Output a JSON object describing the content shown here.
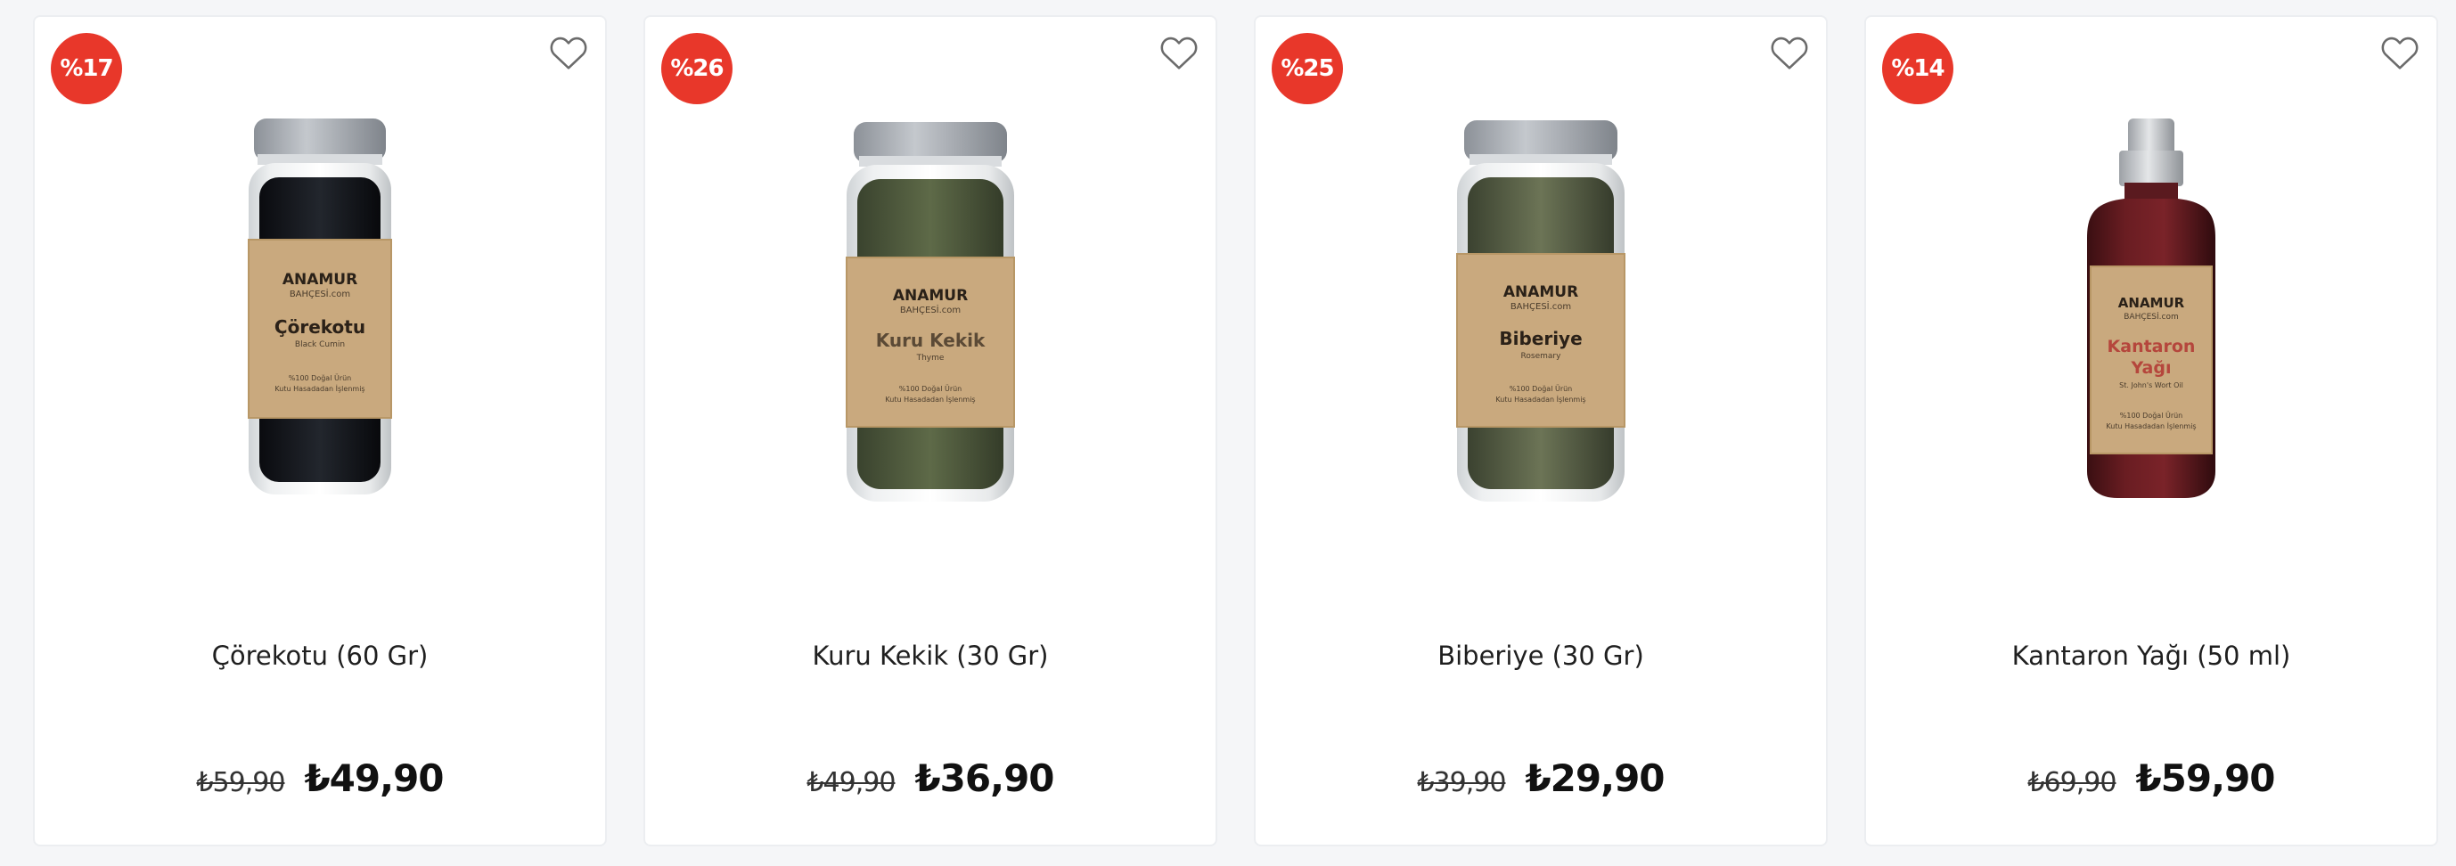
{
  "products": [
    {
      "discount": "%17",
      "name": "Çörekotu (60 Gr)",
      "old_price": "₺59,90",
      "new_price": "₺49,90",
      "icons": {
        "favorite": "heart-outline-icon"
      },
      "label": {
        "brand_line1": "ANAMUR",
        "brand_line2": "BAHÇESİ.com",
        "title": "Çörekotu",
        "subtitle": "Black Cumin",
        "note1": "%100 Doğal Ürün",
        "note2": "Kutu Hasadadan İşlenmiş"
      }
    },
    {
      "discount": "%26",
      "name": "Kuru Kekik (30 Gr)",
      "old_price": "₺49,90",
      "new_price": "₺36,90",
      "icons": {
        "favorite": "heart-outline-icon"
      },
      "label": {
        "brand_line1": "ANAMUR",
        "brand_line2": "BAHÇESİ.com",
        "title": "Kuru Kekik",
        "subtitle": "Thyme",
        "note1": "%100 Doğal Ürün",
        "note2": "Kutu Hasadadan İşlenmiş"
      }
    },
    {
      "discount": "%25",
      "name": "Biberiye (30 Gr)",
      "old_price": "₺39,90",
      "new_price": "₺29,90",
      "icons": {
        "favorite": "heart-outline-icon"
      },
      "label": {
        "brand_line1": "ANAMUR",
        "brand_line2": "BAHÇESİ.com",
        "title": "Biberiye",
        "subtitle": "Rosemary",
        "note1": "%100 Doğal Ürün",
        "note2": "Kutu Hasadadan İşlenmiş"
      }
    },
    {
      "discount": "%14",
      "name": "Kantaron Yağı (50 ml)",
      "old_price": "₺69,90",
      "new_price": "₺59,90",
      "icons": {
        "favorite": "heart-outline-icon"
      },
      "label": {
        "brand_line1": "ANAMUR",
        "brand_line2": "BAHÇESİ.com",
        "title": "Kantaron",
        "title2": "Yağı",
        "subtitle": "St. John's Wort Oil",
        "note1": "%100 Doğal Ürün",
        "note2": "Kutu Hasadadan İşlenmiş"
      }
    }
  ],
  "colors": {
    "page_background": "#f5f6f8",
    "card_background": "#ffffff",
    "discount_badge": "#e8372a",
    "label_kraft": "#c9a97e",
    "kantaron_title": "#b5463c"
  }
}
